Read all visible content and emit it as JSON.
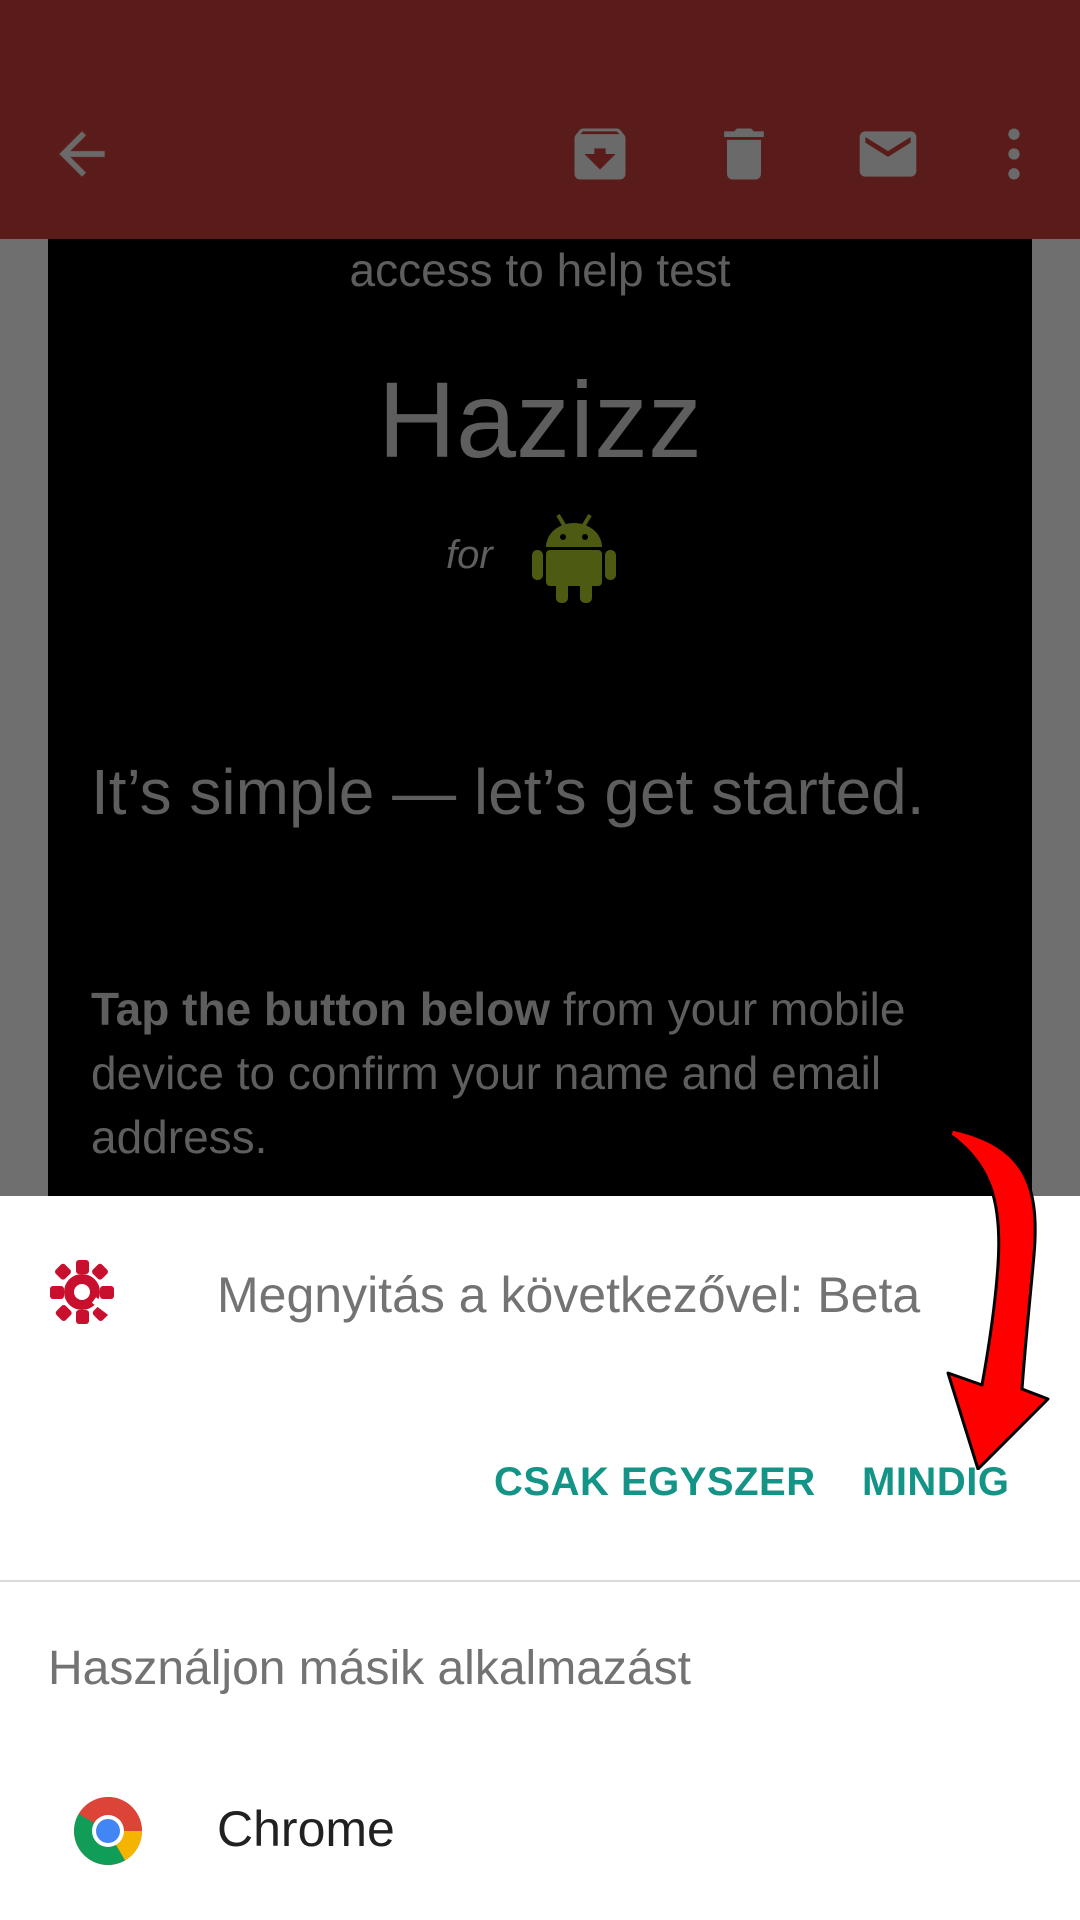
{
  "toolbar": {
    "icons": [
      "back-arrow-icon",
      "archive-icon",
      "delete-icon",
      "mail-icon",
      "more-vert-icon"
    ],
    "color": "#5a1c1a"
  },
  "email": {
    "intro_line": "access to help test",
    "app_name": "Hazizz",
    "for_label": "for",
    "headline": "It’s simple — let’s get started.",
    "body_bold": "Tap the button below",
    "body_rest": " from your mobile device to confirm your name and email address."
  },
  "dialog": {
    "open_with_label": "Megnyitás a következővel: Beta",
    "just_once_button": "CSAK EGYSZER",
    "always_button": "MINDIG",
    "use_other_app_label": "Használjon másik alkalmazást",
    "apps": [
      {
        "name": "Chrome",
        "icon": "chrome-icon"
      }
    ]
  },
  "colors": {
    "accent": "#139486",
    "annotation_arrow": "#ff0000",
    "beta_icon": "#c8102e"
  }
}
